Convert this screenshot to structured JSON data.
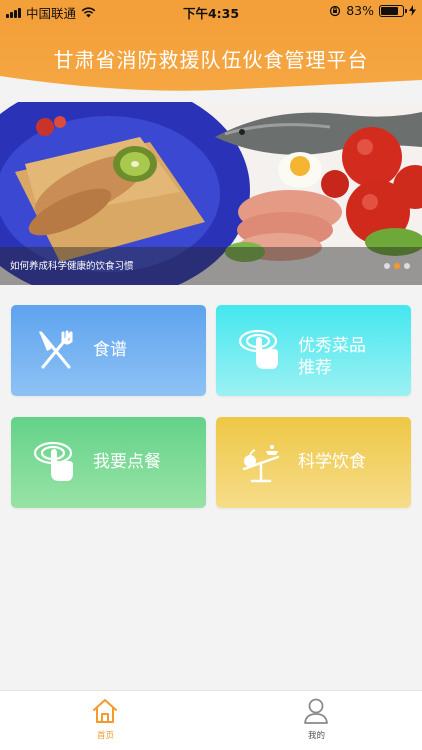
{
  "status_bar": {
    "carrier": "中国联通",
    "time": "下午4:35",
    "battery_percent": "83%",
    "battery_level": 0.83
  },
  "header": {
    "title": "甘肃省消防救援队伍伙食管理平台",
    "color": "#f4a03a"
  },
  "banner": {
    "caption": "如何养成科学健康的饮食习惯",
    "slide_count": 3,
    "active_slide": 2
  },
  "tiles": [
    {
      "label": "食谱",
      "icon": "fork-knife-icon",
      "colors": [
        "#5ea3ee",
        "#8ec2f5"
      ]
    },
    {
      "label": "优秀菜品推荐",
      "line1": "优秀菜品",
      "line2": "推荐",
      "icon": "tap-icon",
      "colors": [
        "#44e7f0",
        "#9cf1f2"
      ]
    },
    {
      "label": "我要点餐",
      "icon": "tap-icon",
      "colors": [
        "#63d289",
        "#98e3a6"
      ]
    },
    {
      "label": "科学饮食",
      "icon": "scale-icon",
      "colors": [
        "#eec745",
        "#f6dd8a"
      ]
    }
  ],
  "tabbar": {
    "items": [
      {
        "label": "首页",
        "icon": "home-icon",
        "active": true,
        "color": "#f39a2b"
      },
      {
        "label": "我的",
        "icon": "user-icon",
        "active": false,
        "color": "#555555"
      }
    ]
  }
}
